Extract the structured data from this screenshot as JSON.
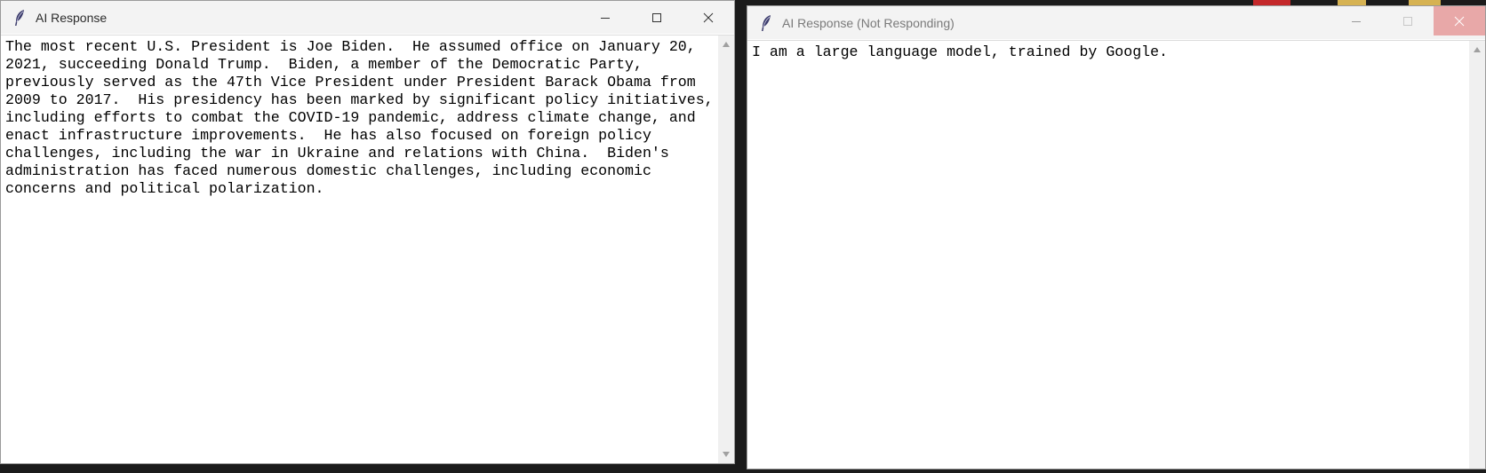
{
  "windows": [
    {
      "title": "AI Response",
      "icon": "feather-icon",
      "caption": {
        "minimize": "minimize-icon",
        "maximize": "maximize-icon",
        "close": "close-icon"
      },
      "text": "The most recent U.S. President is Joe Biden.  He assumed office on January 20,\n2021, succeeding Donald Trump.  Biden, a member of the Democratic Party,\npreviously served as the 47th Vice President under President Barack Obama from\n2009 to 2017.  His presidency has been marked by significant policy initiatives,\nincluding efforts to combat the COVID-19 pandemic, address climate change, and\nenact infrastructure improvements.  He has also focused on foreign policy\nchallenges, including the war in Ukraine and relations with China.  Biden's\nadministration has faced numerous domestic challenges, including economic\nconcerns and political polarization."
    },
    {
      "title": "AI Response (Not Responding)",
      "icon": "feather-icon",
      "caption": {
        "minimize": "minimize-icon",
        "maximize": "maximize-icon",
        "close": "close-icon"
      },
      "text": "I am a large language model, trained by Google."
    }
  ],
  "colors": {
    "titlebar": "#f3f3f3",
    "not_responding_close": "#e8a8a8",
    "desktop": "#1b1b1b"
  }
}
